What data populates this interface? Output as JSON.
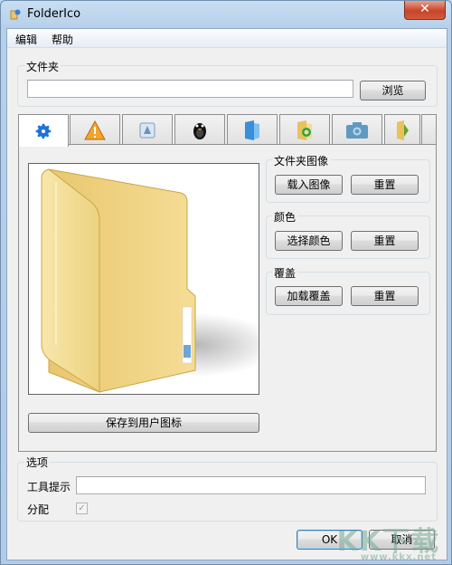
{
  "window": {
    "title": "FolderIco",
    "close_glyph": "✕"
  },
  "menu": {
    "items": [
      "编辑",
      "帮助"
    ]
  },
  "folder_group": {
    "label": "文件夹",
    "path_value": "",
    "browse_label": "浏览"
  },
  "tabs": [
    {
      "icon": "gear-icon",
      "glyph": "⚙",
      "color": "#1e73d8"
    },
    {
      "icon": "warning-icon",
      "glyph": "▲",
      "color": "#f0a020"
    },
    {
      "icon": "app-icon",
      "glyph": "▣",
      "color": "#8aa8c8"
    },
    {
      "icon": "penguin-icon",
      "glyph": "🐧",
      "color": "#111111"
    },
    {
      "icon": "blue-folder-icon",
      "glyph": "▮",
      "color": "#3a8fd8"
    },
    {
      "icon": "recycle-folder-icon",
      "glyph": "♻",
      "color": "#e0a020"
    },
    {
      "icon": "camera-folder-icon",
      "glyph": "◙",
      "color": "#4a90b8"
    },
    {
      "icon": "green-folder-icon",
      "glyph": "▶",
      "color": "#6aa030"
    }
  ],
  "folder_image": {
    "label": "文件夹图像",
    "load_label": "载入图像",
    "reset_label": "重置"
  },
  "color_group": {
    "label": "颜色",
    "pick_label": "选择颜色",
    "reset_label": "重置"
  },
  "overlay_group": {
    "label": "覆盖",
    "load_label": "加载覆盖",
    "reset_label": "重置"
  },
  "save_button": {
    "label": "保存到用户图标"
  },
  "options": {
    "label": "选项",
    "tooltip_label": "工具提示",
    "tooltip_value": "",
    "assign_label": "分配",
    "assign_checked": true,
    "check_glyph": "✓"
  },
  "footer": {
    "ok_label": "OK",
    "cancel_label": "取消"
  },
  "watermark": {
    "text": "KK下载",
    "sub": "www.kkx.net"
  }
}
